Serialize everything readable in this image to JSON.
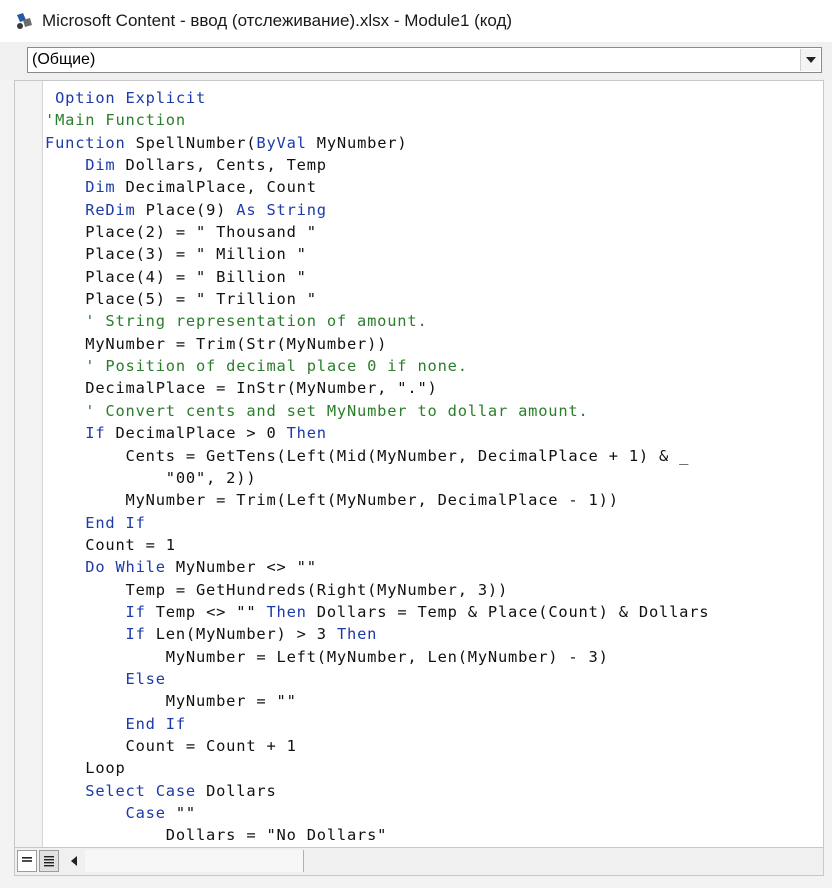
{
  "window": {
    "title": "Microsoft Content - ввод (отслеживание).xlsx - Module1 (код)"
  },
  "object_combo": {
    "value": "(Общие)"
  },
  "colors": {
    "keyword": "#1c3aa8",
    "comment": "#2a7d2a",
    "text": "#111111"
  },
  "icons": {
    "app": "vba-editor-icon",
    "combo_arrow": "dropdown-arrow-icon",
    "procedure_view": "procedure-view-icon",
    "full_module_view": "full-module-view-icon",
    "scroll_left": "scroll-left-arrow-icon"
  },
  "code": [
    [
      {
        "t": " Option Explicit",
        "k": "kw"
      }
    ],
    [
      {
        "t": "'Main Function",
        "k": "cm"
      }
    ],
    [
      {
        "t": "Function ",
        "k": "kw"
      },
      {
        "t": "SpellNumber(",
        "k": "tx"
      },
      {
        "t": "ByVal",
        "k": "kw"
      },
      {
        "t": " MyNumber)",
        "k": "tx"
      }
    ],
    [
      {
        "t": "    ",
        "k": "tx"
      },
      {
        "t": "Dim",
        "k": "kw"
      },
      {
        "t": " Dollars, Cents, Temp",
        "k": "tx"
      }
    ],
    [
      {
        "t": "    ",
        "k": "tx"
      },
      {
        "t": "Dim",
        "k": "kw"
      },
      {
        "t": " DecimalPlace, Count",
        "k": "tx"
      }
    ],
    [
      {
        "t": "    ",
        "k": "tx"
      },
      {
        "t": "ReDim",
        "k": "kw"
      },
      {
        "t": " Place(9) ",
        "k": "tx"
      },
      {
        "t": "As String",
        "k": "kw"
      }
    ],
    [
      {
        "t": "    Place(2) = \" Thousand \"",
        "k": "tx"
      }
    ],
    [
      {
        "t": "    Place(3) = \" Million \"",
        "k": "tx"
      }
    ],
    [
      {
        "t": "    Place(4) = \" Billion \"",
        "k": "tx"
      }
    ],
    [
      {
        "t": "    Place(5) = \" Trillion \"",
        "k": "tx"
      }
    ],
    [
      {
        "t": "    ' String representation of amount.",
        "k": "cm"
      }
    ],
    [
      {
        "t": "    MyNumber = Trim(Str(MyNumber))",
        "k": "tx"
      }
    ],
    [
      {
        "t": "    ' Position of decimal place 0 if none.",
        "k": "cm"
      }
    ],
    [
      {
        "t": "    DecimalPlace = InStr(MyNumber, \".\")",
        "k": "tx"
      }
    ],
    [
      {
        "t": "    ' Convert cents and set MyNumber to dollar amount.",
        "k": "cm"
      }
    ],
    [
      {
        "t": "    ",
        "k": "tx"
      },
      {
        "t": "If",
        "k": "kw"
      },
      {
        "t": " DecimalPlace > 0 ",
        "k": "tx"
      },
      {
        "t": "Then",
        "k": "kw"
      }
    ],
    [
      {
        "t": "        Cents = GetTens(Left(Mid(MyNumber, DecimalPlace + 1) & _",
        "k": "tx"
      }
    ],
    [
      {
        "t": "            \"00\", 2))",
        "k": "tx"
      }
    ],
    [
      {
        "t": "        MyNumber = Trim(Left(MyNumber, DecimalPlace - 1))",
        "k": "tx"
      }
    ],
    [
      {
        "t": "    ",
        "k": "tx"
      },
      {
        "t": "End If",
        "k": "kw"
      }
    ],
    [
      {
        "t": "    Count = 1",
        "k": "tx"
      }
    ],
    [
      {
        "t": "    ",
        "k": "tx"
      },
      {
        "t": "Do While",
        "k": "kw"
      },
      {
        "t": " MyNumber <> \"\"",
        "k": "tx"
      }
    ],
    [
      {
        "t": "        Temp = GetHundreds(Right(MyNumber, 3))",
        "k": "tx"
      }
    ],
    [
      {
        "t": "        ",
        "k": "tx"
      },
      {
        "t": "If",
        "k": "kw"
      },
      {
        "t": " Temp <> \"\" ",
        "k": "tx"
      },
      {
        "t": "Then",
        "k": "kw"
      },
      {
        "t": " Dollars = Temp & Place(Count) & Dollars",
        "k": "tx"
      }
    ],
    [
      {
        "t": "        ",
        "k": "tx"
      },
      {
        "t": "If",
        "k": "kw"
      },
      {
        "t": " Len(MyNumber) > 3 ",
        "k": "tx"
      },
      {
        "t": "Then",
        "k": "kw"
      }
    ],
    [
      {
        "t": "            MyNumber = Left(MyNumber, Len(MyNumber) - 3)",
        "k": "tx"
      }
    ],
    [
      {
        "t": "        ",
        "k": "tx"
      },
      {
        "t": "Else",
        "k": "kw"
      }
    ],
    [
      {
        "t": "            MyNumber = \"\"",
        "k": "tx"
      }
    ],
    [
      {
        "t": "        ",
        "k": "tx"
      },
      {
        "t": "End If",
        "k": "kw"
      }
    ],
    [
      {
        "t": "        Count = Count + 1",
        "k": "tx"
      }
    ],
    [
      {
        "t": "    Loop",
        "k": "tx"
      }
    ],
    [
      {
        "t": "    ",
        "k": "tx"
      },
      {
        "t": "Select Case",
        "k": "kw"
      },
      {
        "t": " Dollars",
        "k": "tx"
      }
    ],
    [
      {
        "t": "        ",
        "k": "tx"
      },
      {
        "t": "Case",
        "k": "kw"
      },
      {
        "t": " \"\"",
        "k": "tx"
      }
    ],
    [
      {
        "t": "            Dollars = \"No Dollars\"",
        "k": "tx"
      }
    ]
  ]
}
